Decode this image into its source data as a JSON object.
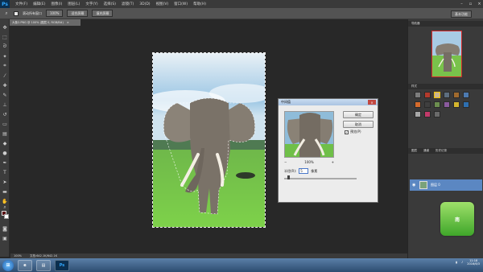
{
  "app": {
    "logo": "Ps"
  },
  "menu": [
    "文件(F)",
    "编辑(E)",
    "图像(I)",
    "图层(L)",
    "文字(Y)",
    "选择(S)",
    "滤镜(T)",
    "3D(D)",
    "视图(V)",
    "窗口(W)",
    "帮助(H)"
  ],
  "options": {
    "scroll_all_windows": "滚动所有窗口",
    "zoom": "100%",
    "fit_screen": "适合屏幕",
    "fill_screen": "填充屏幕",
    "workspace": "基本功能"
  },
  "document": {
    "tab_title": "大象2.PNG @ 100% (图层 0, RGB/8#)",
    "close_glyph": "×"
  },
  "statusbar": {
    "zoom": "100%",
    "doc_info": "文档:642.1K/642.1K"
  },
  "panels": {
    "navigator_tab": "导航器",
    "swatches_tab": "样式",
    "layers_tabs": [
      "图层",
      "通道",
      "历史记录"
    ],
    "layer_name": "图层 0"
  },
  "dialog": {
    "title": "中间值",
    "close_glyph": "×",
    "ok": "确定",
    "cancel": "取消",
    "preview_label": "预览(P)",
    "preview_checked": "✓",
    "zoom_out": "−",
    "zoom_in": "+",
    "zoom": "100%",
    "radius_label": "半径(R):",
    "radius_value": "5",
    "radius_unit": "像素",
    "radius_slider_position": 0.06
  },
  "widget": {
    "label": "南"
  },
  "taskbar": {
    "ps_button": "Ps",
    "time": "11:18",
    "date": "2016/6/3"
  },
  "colors": {
    "foreground": "#5a0f12",
    "background": "#ffffff",
    "selected_layer": "#5b87c2"
  }
}
